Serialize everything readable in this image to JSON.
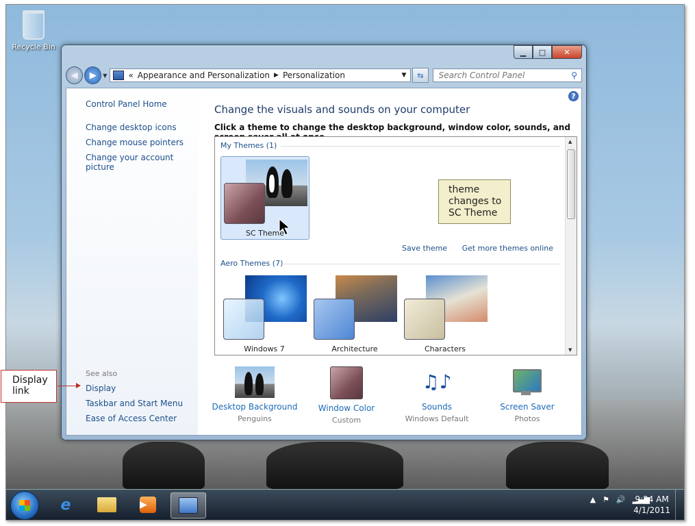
{
  "desktop": {
    "recycle_bin": "Recycle Bin"
  },
  "window": {
    "address": {
      "chevron": "«",
      "crumb1": "Appearance and Personalization",
      "crumb2": "Personalization"
    },
    "search_placeholder": "Search Control Panel",
    "left": {
      "home": "Control Panel Home",
      "links": [
        "Change desktop icons",
        "Change mouse pointers",
        "Change your account picture"
      ],
      "see_also": "See also",
      "see_also_links": [
        "Display",
        "Taskbar and Start Menu",
        "Ease of Access Center"
      ]
    },
    "title": "Change the visuals and sounds on your computer",
    "subtitle": "Click a theme to change the desktop background, window color, sounds, and screen saver all at once.",
    "my_themes": {
      "header": "My Themes (1)",
      "items": [
        {
          "name": "SC Theme"
        }
      ]
    },
    "save_theme": "Save theme",
    "get_more": "Get more themes online",
    "aero_themes": {
      "header": "Aero Themes (7)",
      "items": [
        {
          "name": "Windows 7"
        },
        {
          "name": "Architecture"
        },
        {
          "name": "Characters"
        }
      ]
    },
    "bottom": [
      {
        "label": "Desktop Background",
        "value": "Penguins",
        "icon": "penguins-thumb-icon"
      },
      {
        "label": "Window Color",
        "value": "Custom",
        "icon": "color-swatch-icon"
      },
      {
        "label": "Sounds",
        "value": "Windows Default",
        "icon": "music-notes-icon"
      },
      {
        "label": "Screen Saver",
        "value": "Photos",
        "icon": "screen-saver-icon"
      }
    ]
  },
  "callout": {
    "line1": "theme",
    "line2": "changes to",
    "line3": "SC Theme"
  },
  "annotation": {
    "line1": "Display",
    "line2": "link"
  },
  "taskbar": {
    "time": "9:24 AM",
    "date": "4/1/2011"
  },
  "colors": {
    "link": "#1c4f8a",
    "title": "#1e3a6a",
    "annotation": "#c0302a"
  }
}
